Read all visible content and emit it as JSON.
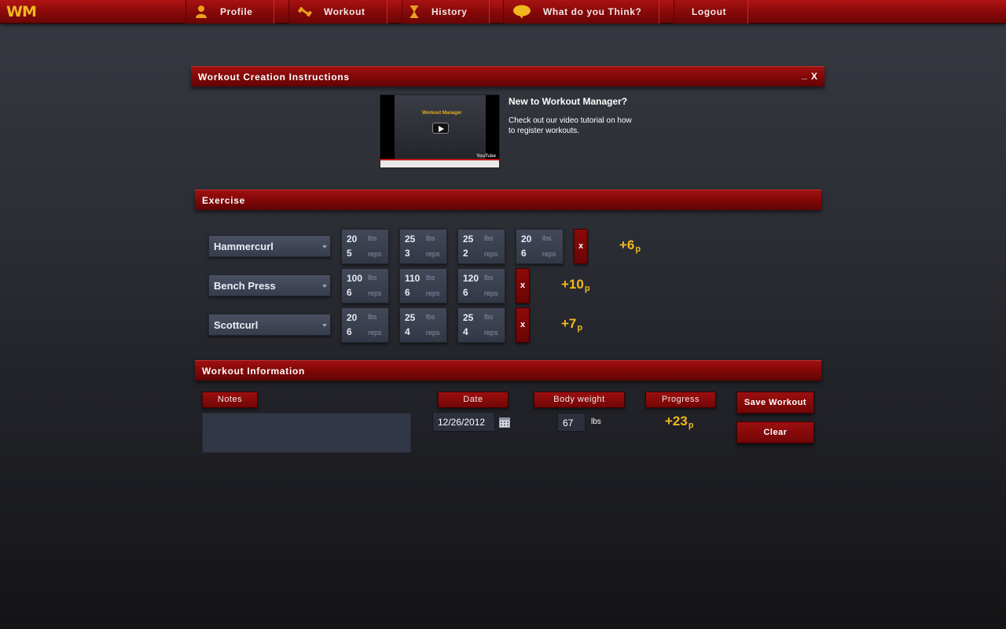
{
  "app": {
    "logo": "WM"
  },
  "nav": {
    "items": [
      {
        "label": "Profile",
        "icon": "person-icon"
      },
      {
        "label": "Workout",
        "icon": "dumbbell-icon"
      },
      {
        "label": "History",
        "icon": "hourglass-icon"
      },
      {
        "label": "What do you Think?",
        "icon": "speech-bubble-icon"
      },
      {
        "label": "Logout"
      }
    ]
  },
  "instructions": {
    "title": "Workout Creation Instructions",
    "minimize": "_",
    "close": "X",
    "video_title": "Workout Manager",
    "video_brand": "YouTube",
    "heading": "New to Workout Manager?",
    "body": "Check out our video tutorial on how to register workouts."
  },
  "exercise": {
    "title": "Exercise",
    "weight_unit": "lbs",
    "reps_unit": "reps",
    "remove_label": "x",
    "rows": [
      {
        "name": "Hammercurl",
        "points": "+6",
        "points_unit": "p",
        "sets": [
          {
            "weight": "20",
            "reps": "5"
          },
          {
            "weight": "25",
            "reps": "3"
          },
          {
            "weight": "25",
            "reps": "2"
          },
          {
            "weight": "20",
            "reps": "6"
          }
        ]
      },
      {
        "name": "Bench Press",
        "points": "+10",
        "points_unit": "p",
        "sets": [
          {
            "weight": "100",
            "reps": "6"
          },
          {
            "weight": "110",
            "reps": "6"
          },
          {
            "weight": "120",
            "reps": "6"
          }
        ]
      },
      {
        "name": "Scottcurl",
        "points": "+7",
        "points_unit": "p",
        "sets": [
          {
            "weight": "20",
            "reps": "6"
          },
          {
            "weight": "25",
            "reps": "4"
          },
          {
            "weight": "25",
            "reps": "4"
          }
        ]
      }
    ]
  },
  "info": {
    "title": "Workout Information",
    "notes_label": "Notes",
    "notes_value": "",
    "date_label": "Date",
    "date_value": "12/26/2012",
    "bodyweight_label": "Body weight",
    "bodyweight_value": "67",
    "bodyweight_unit": "lbs",
    "progress_label": "Progress",
    "progress_value": "+23",
    "progress_unit": "p",
    "save_label": "Save Workout",
    "clear_label": "Clear"
  },
  "colors": {
    "accent": "#8a0a0a",
    "points": "#f0b81c",
    "logo": "#f0b81c"
  }
}
